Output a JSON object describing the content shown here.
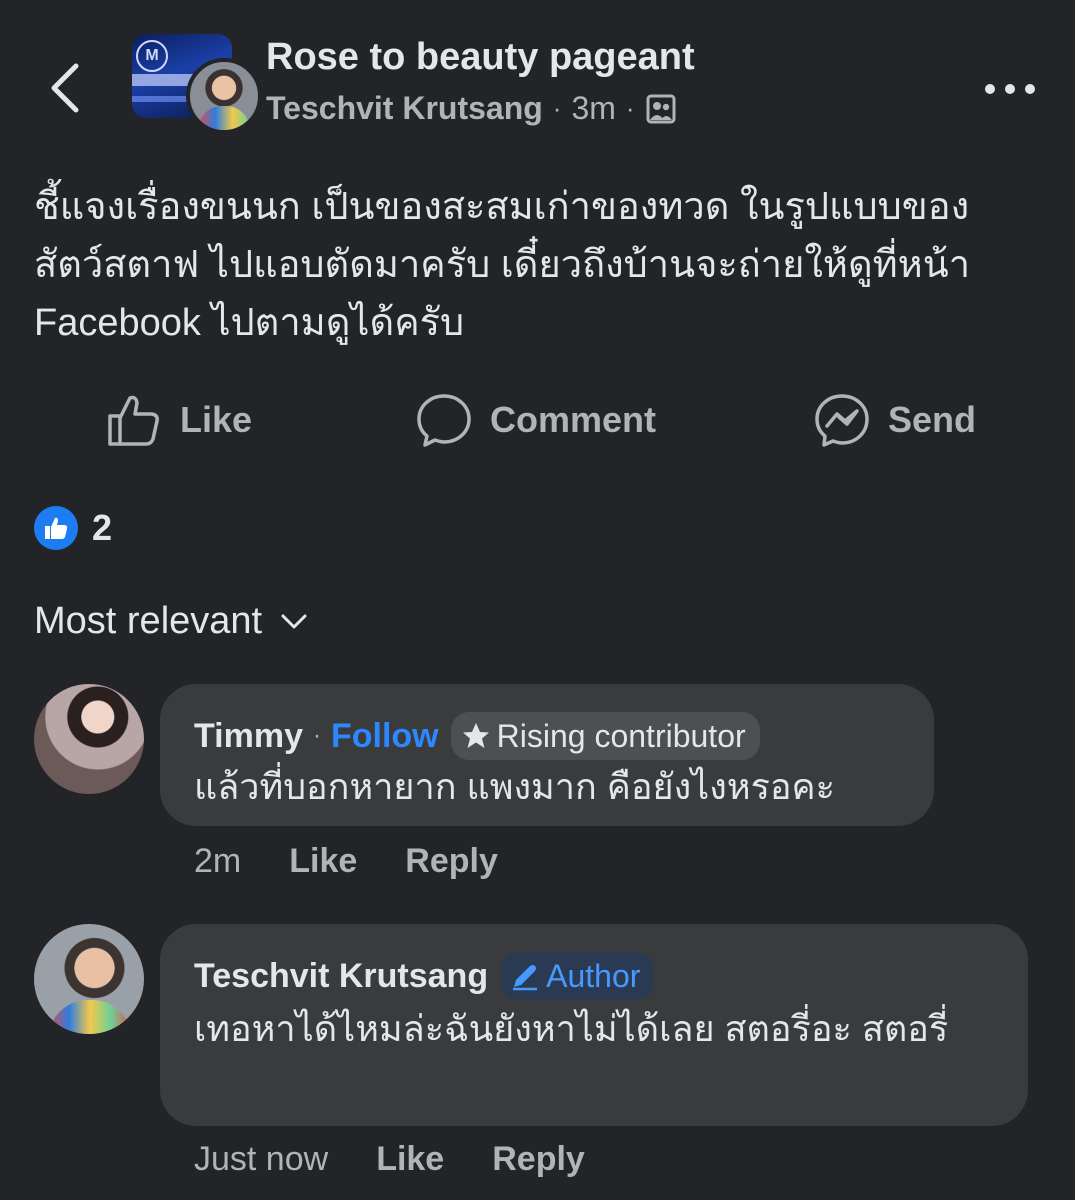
{
  "header": {
    "title": "Rose to beauty pageant",
    "author": "Teschvit Krutsang",
    "time": "3m",
    "separator": "·",
    "audience_icon": "group-members-icon",
    "more_icon": "more-horizontal-icon",
    "back_icon": "chevron-left-icon"
  },
  "post": {
    "text_lines": [
      "ชี้แจงเรื่องขนนก เป็นของสะสมเก่าของทวด ในรูปแบบของ",
      "สัตว์สตาฟ ไปแอบตัดมาครับ เดี๋ยวถึงบ้านจะถ่ายให้ดูที่หน้า",
      "Facebook ไปตามดูได้ครับ"
    ]
  },
  "actions": {
    "like": "Like",
    "comment": "Comment",
    "send": "Send"
  },
  "reactions": {
    "type": "like",
    "count": "2",
    "color": "#1d7cf2"
  },
  "sort": {
    "label": "Most relevant"
  },
  "comments": [
    {
      "name": "Timmy",
      "separator": "·",
      "follow": "Follow",
      "badge": "Rising contributor",
      "text": "แล้วที่บอกหายาก แพงมาก คือยังไงหรอคะ",
      "time": "2m",
      "like": "Like",
      "reply": "Reply"
    },
    {
      "name": "Teschvit Krutsang",
      "badge": "Author",
      "text": "เทอหาได้ไหมล่ะฉันยังหาไม่ได้เลย สตอรี่อะ สตอรี่",
      "time": "Just now",
      "like": "Like",
      "reply": "Reply"
    }
  ],
  "colors": {
    "background": "#232427",
    "bubble": "#3a3b3c",
    "accent": "#2d88ff"
  }
}
